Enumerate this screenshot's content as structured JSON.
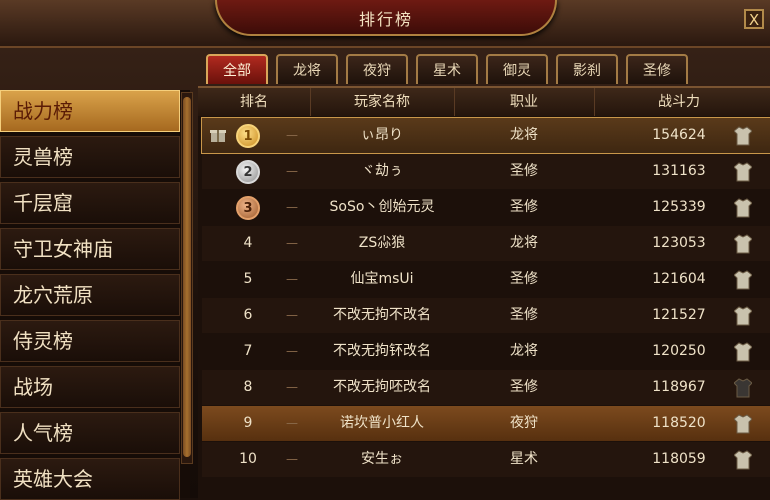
{
  "window": {
    "title": "排行榜",
    "close": "X"
  },
  "tabs": [
    {
      "label": "全部"
    },
    {
      "label": "龙将"
    },
    {
      "label": "夜狩"
    },
    {
      "label": "星术"
    },
    {
      "label": "御灵"
    },
    {
      "label": "影刹"
    },
    {
      "label": "圣修"
    }
  ],
  "active_tab": "全部",
  "sidebar": {
    "items": [
      {
        "label": "战力榜"
      },
      {
        "label": "灵兽榜"
      },
      {
        "label": "千层窟"
      },
      {
        "label": "守卫女神庙"
      },
      {
        "label": "龙穴荒原"
      },
      {
        "label": "侍灵榜"
      },
      {
        "label": "战场"
      },
      {
        "label": "人气榜"
      },
      {
        "label": "英雄大会"
      }
    ],
    "active": "战力榜"
  },
  "table": {
    "headers": {
      "rank": "排名",
      "name": "玩家名称",
      "job": "职业",
      "power": "战斗力"
    },
    "rows": [
      {
        "rank": "1",
        "trend": "—",
        "name": "ぃ昂り",
        "job": "龙将",
        "power": "154624"
      },
      {
        "rank": "2",
        "trend": "—",
        "name": "ヾ劫ぅ",
        "job": "圣修",
        "power": "131163"
      },
      {
        "rank": "3",
        "trend": "—",
        "name": "SoSo丶创始元灵",
        "job": "圣修",
        "power": "125339"
      },
      {
        "rank": "4",
        "trend": "—",
        "name": "ZS尛狼",
        "job": "龙将",
        "power": "123053"
      },
      {
        "rank": "5",
        "trend": "—",
        "name": "仙宝msUi",
        "job": "圣修",
        "power": "121604"
      },
      {
        "rank": "6",
        "trend": "—",
        "name": "不改无拘不改名",
        "job": "圣修",
        "power": "121527"
      },
      {
        "rank": "7",
        "trend": "—",
        "name": "不改无拘钚改名",
        "job": "龙将",
        "power": "120250"
      },
      {
        "rank": "8",
        "trend": "—",
        "name": "不改无拘呸改名",
        "job": "圣修",
        "power": "118967"
      },
      {
        "rank": "9",
        "trend": "—",
        "name": "诺坎普小红人",
        "job": "夜狩",
        "power": "118520"
      },
      {
        "rank": "10",
        "trend": "—",
        "name": "安生ぉ",
        "job": "星术",
        "power": "118059"
      }
    ]
  },
  "icons": {
    "gift": "gift-icon",
    "costume": "shirt-icon"
  }
}
